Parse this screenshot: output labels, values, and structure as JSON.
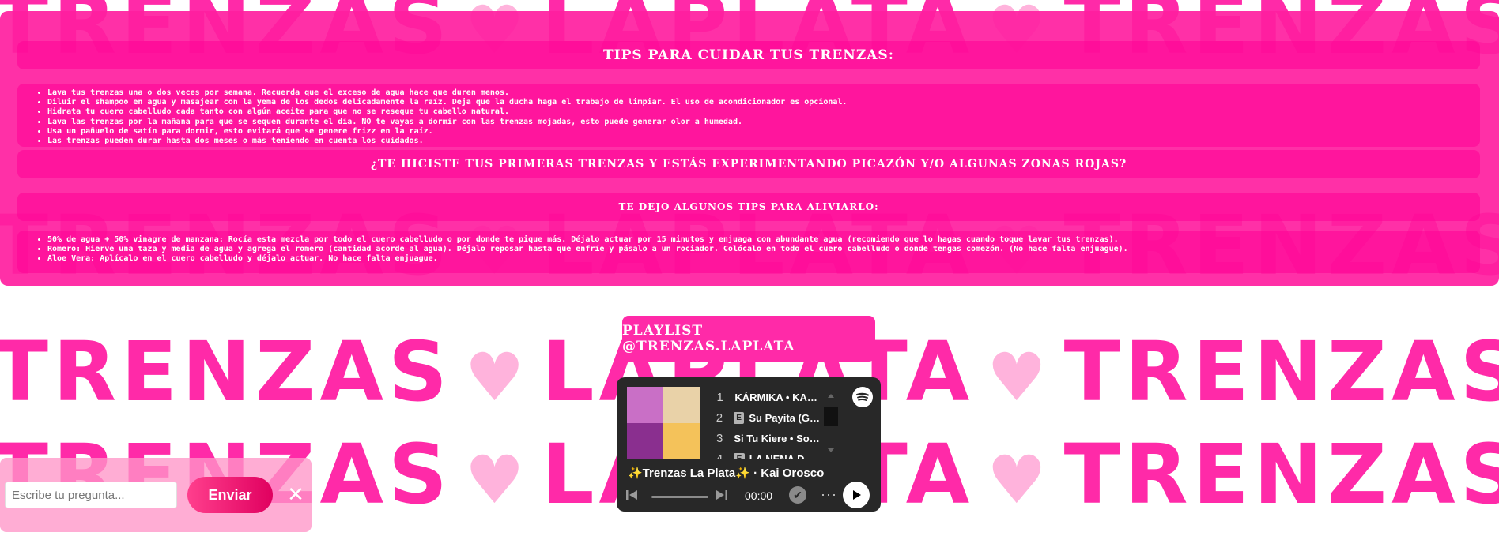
{
  "background": {
    "word1": "TRENZAS",
    "word2": "LAPLATA",
    "heart": "♥"
  },
  "tips": {
    "title": "TIPS PARA CUIDAR TUS TRENZAS:",
    "items": [
      "Lava tus trenzas una o dos veces por semana. Recuerda que el exceso de agua hace que duren menos.",
      "Diluir el shampoo en agua y masajear con la yema de los dedos delicadamente la raíz. Deja que la ducha haga el trabajo de limpiar. El uso de acondicionador es opcional.",
      "Hidrata tu cuero cabelludo cada tanto con algún aceite para que no se reseque tu cabello natural.",
      "Lava las trenzas por la mañana para que se sequen durante el día. NO te vayas a dormir con las trenzas mojadas, esto puede generar olor a humedad.",
      "Usa un pañuelo de satín para dormir, esto evitará que se genere frizz en la raíz.",
      "Las trenzas pueden durar hasta dos meses o más teniendo en cuenta los cuidados."
    ],
    "question": "¿TE HICISTE TUS PRIMERAS TRENZAS Y ESTÁS EXPERIMENTANDO PICAZÓN Y/O ALGUNAS ZONAS ROJAS?",
    "relief_title": "TE DEJO ALGUNOS TIPS PARA ALIVIARLO:",
    "relief_items": [
      "50% de agua + 50% vinagre de manzana: Rocía esta mezcla por todo el cuero cabelludo o por donde te pique más. Déjalo actuar por 15 minutos y enjuaga con abundante agua (recomiendo que lo hagas cuando toque lavar tus trenzas).",
      "Romero: Hierve una taza y media de agua y agrega el romero (cantidad acorde al agua). Déjalo reposar hasta que enfríe y pásalo a un rociador. Colócalo en todo el cuero cabelludo o donde tengas comezón. (No hace falta enjuague).",
      "Aloe Vera: Aplícalo en el cuero cabelludo y déjalo actuar. No hace falta enjuague."
    ]
  },
  "playlist": {
    "label": "PLAYLIST @TRENZAS.LAPLATA",
    "tracks": [
      {
        "num": "1",
        "explicit": false,
        "title": "KÁRMIKA • KAR..."
      },
      {
        "num": "2",
        "explicit": true,
        "title": "Su Payita (Gram"
      },
      {
        "num": "3",
        "explicit": false,
        "title": "Si Tu Kiere • Soto..."
      },
      {
        "num": "4",
        "explicit": true,
        "title": "LA NENA DE AL"
      }
    ],
    "explicit_badge": "E",
    "now_playing": "✨Trenzas La Plata✨ · Kai Orosco",
    "time": "00:00",
    "icons": {
      "logo": "spotify-icon",
      "prev": "skip-back-icon",
      "next": "skip-forward-icon",
      "save": "check-circle-icon",
      "more": "more-icon",
      "play": "play-icon"
    }
  },
  "chat": {
    "placeholder": "Escribe tu pregunta...",
    "send_label": "Enviar",
    "close_glyph": "✕"
  },
  "colors": {
    "brand_pink": "#ff2aa8",
    "card_pink": "#ff1ea0",
    "light_pink": "#ffb3dc",
    "player_bg": "#282828"
  }
}
